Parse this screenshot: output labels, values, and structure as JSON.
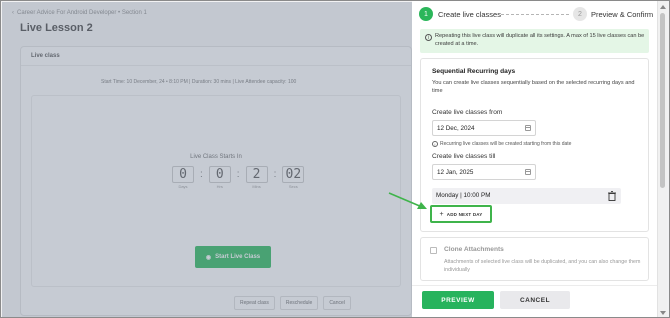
{
  "background": {
    "breadcrumb": "Career Advice For Android Developer • Section 1",
    "page_title": "Live Lesson 2",
    "card_header": "Live class",
    "meta": "Start Time: 10 December, 24 • 8:10 PM  |  Duration: 30 mins  |  Live Attendee capacity: 100",
    "starts_in": "Live Class Starts In",
    "countdown": [
      {
        "value": "0",
        "unit": "Days"
      },
      {
        "value": "0",
        "unit": "Hrs"
      },
      {
        "value": "2",
        "unit": "Mins"
      },
      {
        "value": "02",
        "unit": "Secs"
      }
    ],
    "start_button": "Start Live Class",
    "actions": [
      "Repeat class",
      "Reschedule",
      "Cancel"
    ]
  },
  "drawer": {
    "steps": [
      {
        "number": "1",
        "label": "Create live classes"
      },
      {
        "number": "2",
        "label": "Preview & Confirm"
      }
    ],
    "info": "Repeating this live class will duplicate all its settings. A max of 15 live classes can be created at a time.",
    "sequential": {
      "title": "Sequential Recurring days",
      "description": "You can create live classes sequentially based on the selected recurring days and time",
      "from_label": "Create live classes from",
      "from_value": "12 Dec, 2024",
      "hint": "Recurring live classes will be created starting from this date",
      "till_label": "Create live classes till",
      "till_value": "12 Jan, 2025",
      "day_row": "Monday | 10:00 PM",
      "add_next_day": "ADD NEXT DAY"
    },
    "clone": {
      "title": "Clone Attachments",
      "description": "Attachments of selected live class will be duplicated, and you can also change them individually"
    },
    "footer": {
      "preview": "PREVIEW",
      "cancel": "CANCEL"
    }
  },
  "colors": {
    "accent_green": "#27b35d",
    "highlight_green": "#3fb44b",
    "info_bg": "#e4f6e6"
  }
}
